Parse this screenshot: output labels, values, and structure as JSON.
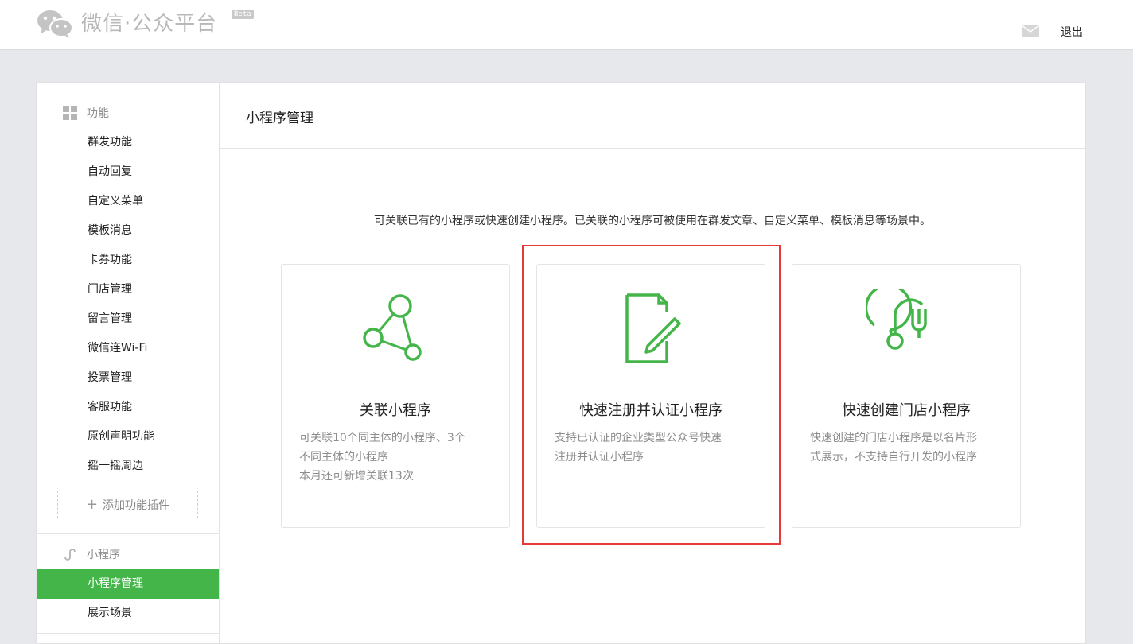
{
  "header": {
    "logo_text": "微信·公众平台",
    "badge": "Beta",
    "logout_label": "退出"
  },
  "sidebar": {
    "function_group": "功能",
    "function_items": [
      "群发功能",
      "自动回复",
      "自定义菜单",
      "模板消息",
      "卡券功能",
      "门店管理",
      "留言管理",
      "微信连Wi-Fi",
      "投票管理",
      "客服功能",
      "原创声明功能",
      "摇一摇周边"
    ],
    "add_plugin_label": "添加功能插件",
    "miniprogram_group": "小程序",
    "miniprogram_items": [
      "小程序管理",
      "展示场景"
    ],
    "active_item": "小程序管理"
  },
  "main": {
    "title": "小程序管理",
    "description": "可关联已有的小程序或快速创建小程序。已关联的小程序可被使用在群发文章、自定义菜单、模板消息等场景中。",
    "cards": [
      {
        "title": "关联小程序",
        "icon": "link-nodes-icon",
        "desc": [
          "可关联10个同主体的小程序、3个",
          "不同主体的小程序",
          "本月还可新增关联13次"
        ]
      },
      {
        "title": "快速注册并认证小程序",
        "icon": "document-pen-icon",
        "desc": [
          "支持已认证的企业类型公众号快速",
          "注册并认证小程序"
        ]
      },
      {
        "title": "快速创建门店小程序",
        "icon": "store-fork-icon",
        "desc": [
          "快速创建的门店小程序是以名片形",
          "式展示，不支持自行开发的小程序"
        ]
      }
    ]
  },
  "colors": {
    "accent": "#44b549",
    "highlight": "#e53a3a"
  }
}
